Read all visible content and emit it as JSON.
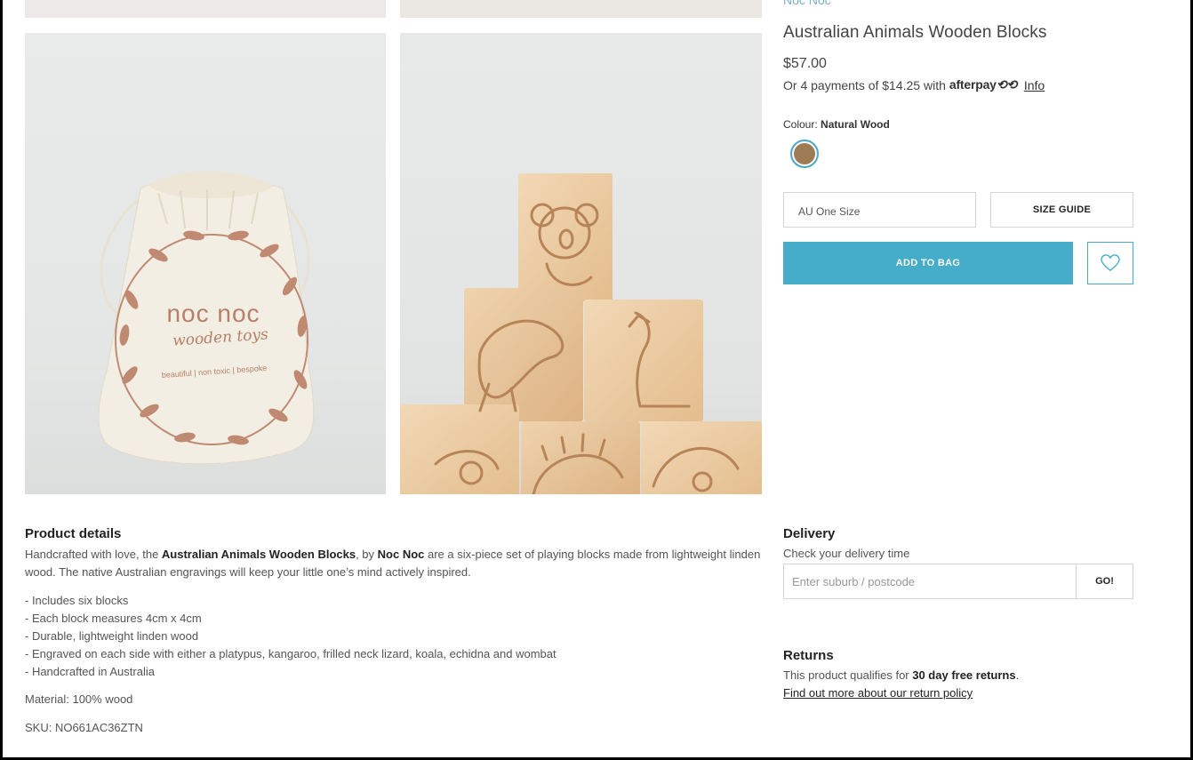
{
  "product": {
    "brand": "Noc Noc",
    "title": "Australian Animals Wooden Blocks",
    "price": "$57.00",
    "afterpay_prefix": "Or 4 payments of $14.25 with",
    "afterpay_logo": "afterpay",
    "afterpay_info": "Info",
    "colour_label": "Colour:",
    "colour_value": "Natural Wood",
    "swatch_color": "#9d7b55",
    "size_value": "AU One Size",
    "size_guide_label": "SIZE GUIDE",
    "add_to_bag_label": "ADD TO BAG",
    "accent_color": "#45acc9"
  },
  "images": {
    "bag_brand_line1": "noc noc",
    "bag_brand_line2": "wooden toys",
    "bag_tagline": "beautiful | non toxic | bespoke"
  },
  "details": {
    "title": "Product details",
    "desc_part1": "Handcrafted with love, the ",
    "desc_bold1": "Australian Animals Wooden Blocks",
    "desc_part2": ", by ",
    "desc_bold2": "Noc Noc",
    "desc_part3": " are a six-piece set of playing blocks made from lightweight linden wood. The native Australian engravings will keep your little one’s mind actively inspired.",
    "bullets": [
      "- Includes six blocks",
      "- Each block measures 4cm x 4cm",
      "- Durable, lightweight linden wood",
      "- Engraved on each side with either a platypus, kangaroo, frilled neck lizard, koala, echidna and wombat",
      "- Handcrafted in Australia"
    ],
    "material": "Material: 100% wood",
    "sku": "SKU: NO661AC36ZTN"
  },
  "delivery": {
    "title": "Delivery",
    "subtitle": "Check your delivery time",
    "placeholder": "Enter suburb / postcode",
    "go_label": "GO!"
  },
  "returns": {
    "title": "Returns",
    "text_prefix": "This product qualifies for ",
    "text_bold": "30 day free returns",
    "text_suffix": ".",
    "link": "Find out more about our return policy"
  }
}
